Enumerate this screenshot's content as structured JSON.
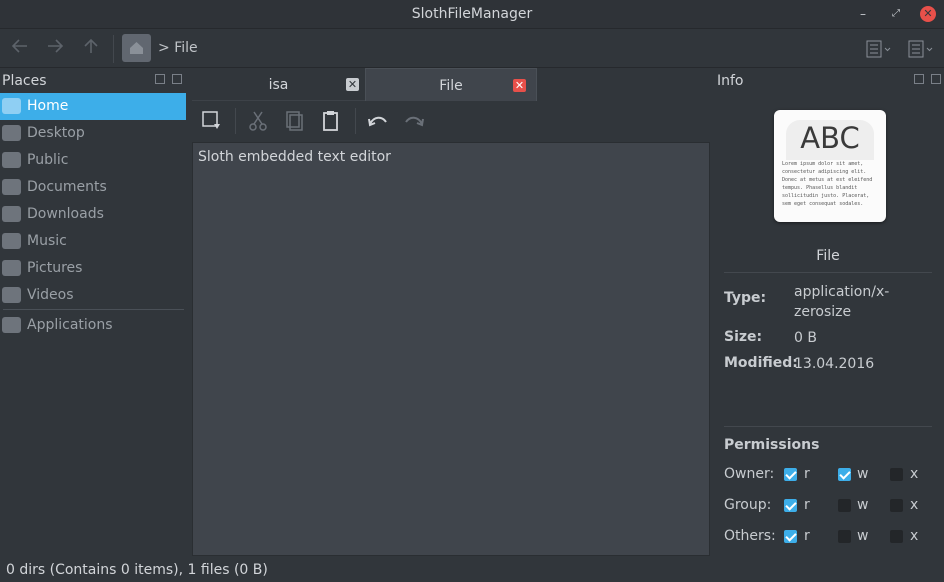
{
  "window": {
    "title": "SlothFileManager"
  },
  "toolbar": {
    "breadcrumb_sep": ">",
    "breadcrumb_current": "File"
  },
  "places": {
    "title": "Places",
    "items": [
      {
        "label": "Home",
        "icon": "home-icon",
        "active": true
      },
      {
        "label": "Desktop",
        "icon": "folder-icon"
      },
      {
        "label": "Public",
        "icon": "share-folder-icon"
      },
      {
        "label": "Documents",
        "icon": "folder-icon"
      },
      {
        "label": "Downloads",
        "icon": "download-folder-icon"
      },
      {
        "label": "Music",
        "icon": "music-folder-icon"
      },
      {
        "label": "Pictures",
        "icon": "pictures-folder-icon"
      },
      {
        "label": "Videos",
        "icon": "video-folder-icon"
      },
      {
        "label": "Applications",
        "icon": "gear-icon"
      }
    ]
  },
  "tabs": [
    {
      "label": "isa",
      "active": false
    },
    {
      "label": "File",
      "active": true
    }
  ],
  "editor": {
    "content": "Sloth embedded text editor"
  },
  "info": {
    "title": "Info",
    "icon_text": "ABC",
    "icon_lorem": "Lorem ipsum dolor sit amet, consectetur adipiscing elit. Donec at metus at est eleifend tempus. Phasellus blandit sollicitudin justo. Placerat, sem eget consequat sodales.",
    "filename": "File",
    "type_label": "Type:",
    "type_value": "application/x-zerosize",
    "size_label": "Size:",
    "size_value": "0 B",
    "modified_label": "Modified:",
    "modified_value": "13.04.2016"
  },
  "permissions": {
    "title": "Permissions",
    "rows": [
      {
        "who": "Owner:",
        "r": true,
        "w": true,
        "x": false
      },
      {
        "who": "Group:",
        "r": true,
        "w": false,
        "x": false
      },
      {
        "who": "Others:",
        "r": true,
        "w": false,
        "x": false
      }
    ],
    "labels": {
      "r": "r",
      "w": "w",
      "x": "x"
    }
  },
  "status": {
    "text": "0 dirs (Contains 0 items), 1 files (0 B)"
  },
  "colors": {
    "accent": "#3daee9",
    "close": "#e8504a",
    "background": "#31363b"
  }
}
